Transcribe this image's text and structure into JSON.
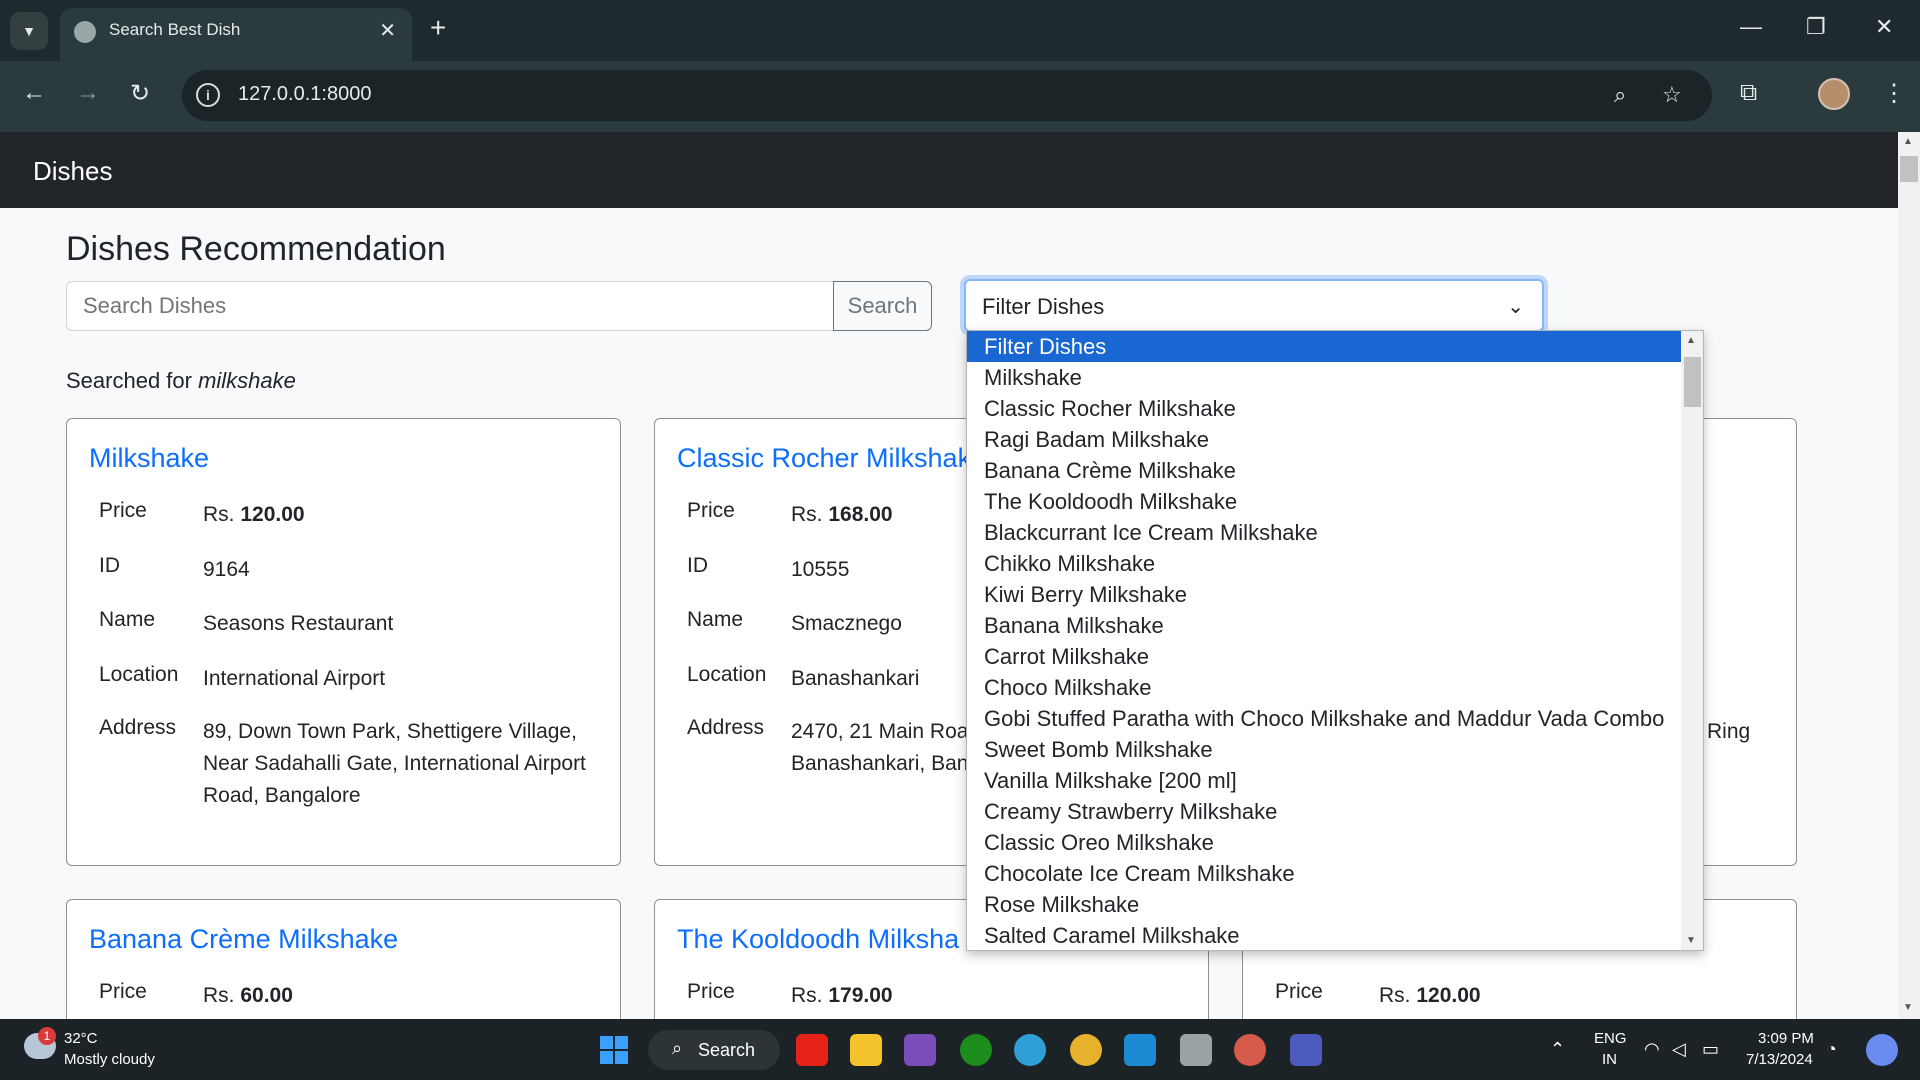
{
  "browser": {
    "tab_title": "Search Best Dish",
    "url": "127.0.0.1:8000",
    "new_tab": "+",
    "tab_close": "✕"
  },
  "navbar": {
    "brand": "Dishes"
  },
  "page": {
    "title": "Dishes Recommendation",
    "search_placeholder": "Search Dishes",
    "search_button": "Search",
    "filter_selected": "Filter Dishes",
    "searched_prefix": "Searched for ",
    "searched_term": "milkshake"
  },
  "labels": {
    "price": "Price",
    "id": "ID",
    "name": "Name",
    "location": "Location",
    "address": "Address",
    "currency": "Rs. "
  },
  "cards": [
    {
      "title": "Milkshake",
      "price": "120.00",
      "id": "9164",
      "name": "Seasons Restaurant",
      "location": "International Airport",
      "address": "89, Down Town Park, Shettigere Village, Near Sadahalli Gate, International Airport Road, Bangalore"
    },
    {
      "title": "Classic Rocher Milkshak",
      "price": "168.00",
      "id": "10555",
      "name": "Smacznego",
      "location": "Banashankari",
      "address": "2470, 21 Main Roa Banashankari, Ban"
    },
    {
      "address_fragment": "Ring"
    },
    {
      "title": "Banana Crème Milkshake",
      "price": "60.00"
    },
    {
      "title": "The Kooldoodh Milksha",
      "price": "179.00"
    },
    {
      "price": "120.00"
    }
  ],
  "dropdown_options": [
    "Filter Dishes",
    "Milkshake",
    "Classic Rocher Milkshake",
    "Ragi Badam Milkshake",
    "Banana Crème Milkshake",
    "The Kooldoodh Milkshake",
    "Blackcurrant Ice Cream Milkshake",
    "Chikko Milkshake",
    "Kiwi Berry Milkshake",
    "Banana Milkshake",
    "Carrot Milkshake",
    "Choco Milkshake",
    "Gobi Stuffed Paratha with Choco Milkshake and Maddur Vada Combo",
    "Sweet Bomb Milkshake",
    "Vanilla Milkshake [200 ml]",
    "Creamy Strawberry Milkshake",
    "Classic Oreo Milkshake",
    "Chocolate Ice Cream Milkshake",
    "Rose Milkshake",
    "Salted Caramel Milkshake"
  ],
  "taskbar": {
    "weather_badge": "1",
    "temperature": "32°C",
    "weather": "Mostly cloudy",
    "search_label": "Search",
    "lang_top": "ENG",
    "lang_bottom": "IN",
    "time": "3:09 PM",
    "date": "7/13/2024"
  },
  "icons": {
    "tab_search": "chevron-down-icon",
    "back": "arrow-left-icon",
    "forward": "arrow-right-icon",
    "reload": "reload-icon",
    "zoom": "zoom-icon",
    "bookmark": "star-icon",
    "extensions": "puzzle-icon",
    "menu": "kebab-menu-icon"
  },
  "colors": {
    "accent": "#0d6efd",
    "navbar": "#212529",
    "dropdown_selected": "#1967d2"
  }
}
